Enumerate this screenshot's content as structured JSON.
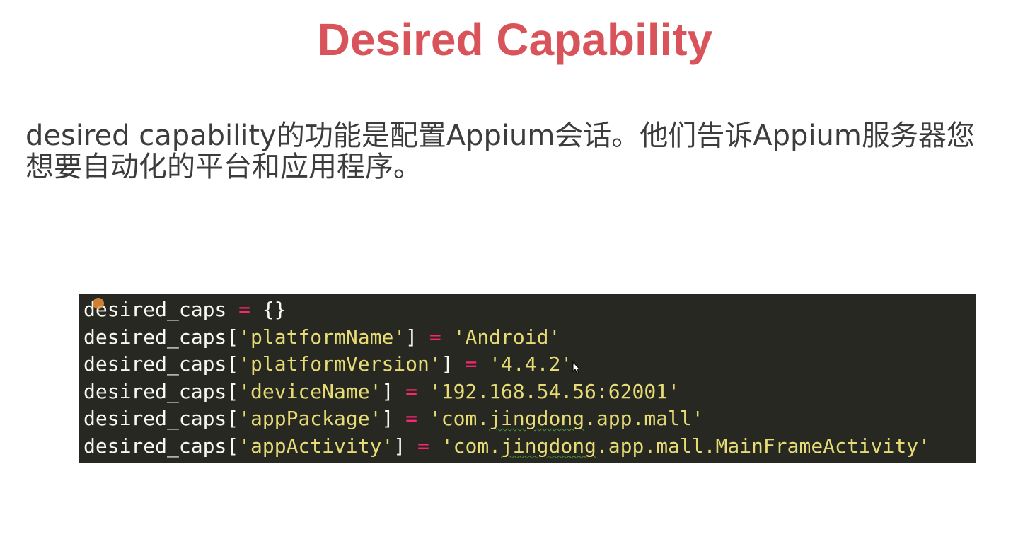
{
  "slide": {
    "title": "Desired Capability",
    "description": "desired capability的功能是配置Appium会话。他们告诉Appium服务器您想要自动化的平台和应用程序。"
  },
  "code": {
    "lines": [
      {
        "var": "desired_caps",
        "op": "=",
        "rest": "{}"
      },
      {
        "var": "desired_caps",
        "key": "'platformName'",
        "op": "=",
        "value": "'Android'"
      },
      {
        "var": "desired_caps",
        "key": "'platformVersion'",
        "op": "=",
        "value": "'4.4.2'"
      },
      {
        "var": "desired_caps",
        "key": "'deviceName'",
        "op": "=",
        "value": "'192.168.54.56:62001'"
      },
      {
        "var": "desired_caps",
        "key": "'appPackage'",
        "op": "=",
        "value_prefix": "'com.",
        "value_squiggle": "jingdong",
        "value_suffix": ".app.mall'"
      },
      {
        "var": "desired_caps",
        "key": "'appActivity'",
        "op": "=",
        "value_prefix": "'com.",
        "value_squiggle": "jingdong",
        "value_suffix": ".app.mall.MainFrameActivity'"
      }
    ]
  },
  "colors": {
    "title": "#d9545a",
    "code_background": "#272822",
    "string": "#e6db74",
    "operator": "#f92672",
    "identifier": "#f8f8f2"
  },
  "icons": {
    "breakpoint": "breakpoint-dot-icon",
    "cursor": "mouse-cursor-icon"
  }
}
